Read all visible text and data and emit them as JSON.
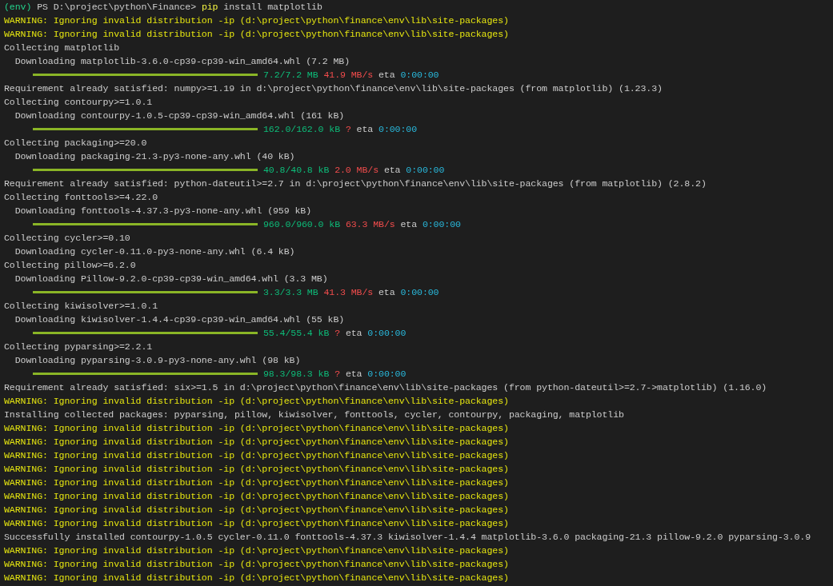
{
  "terminal": {
    "lines": [
      {
        "kind": "prompt",
        "env": "(env)",
        "path": " PS D:\\project\\python\\Finance> ",
        "command": "pip",
        "args": " install matplotlib"
      },
      {
        "kind": "warning",
        "text": "WARNING: Ignoring invalid distribution -ip (d:\\project\\python\\finance\\env\\lib\\site-packages)"
      },
      {
        "kind": "warning",
        "text": "WARNING: Ignoring invalid distribution -ip (d:\\project\\python\\finance\\env\\lib\\site-packages)"
      },
      {
        "kind": "text",
        "text": "Collecting matplotlib"
      },
      {
        "kind": "text",
        "text": "  Downloading matplotlib-3.6.0-cp39-cp39-win_amd64.whl (7.2 MB)"
      },
      {
        "kind": "progress",
        "level": 1,
        "size": "7.2/7.2 MB",
        "speed": "41.9 MB/s",
        "eta_label": "eta",
        "eta": "0:00:00"
      },
      {
        "kind": "text",
        "text": "Requirement already satisfied: numpy>=1.19 in d:\\project\\python\\finance\\env\\lib\\site-packages (from matplotlib) (1.23.3)"
      },
      {
        "kind": "text",
        "text": "Collecting contourpy>=1.0.1"
      },
      {
        "kind": "text",
        "text": "  Downloading contourpy-1.0.5-cp39-cp39-win_amd64.whl (161 kB)"
      },
      {
        "kind": "progress",
        "level": 1,
        "size": "162.0/162.0 kB",
        "speed": "?",
        "eta_label": "eta",
        "eta": "0:00:00"
      },
      {
        "kind": "text",
        "text": "Collecting packaging>=20.0"
      },
      {
        "kind": "text",
        "text": "  Downloading packaging-21.3-py3-none-any.whl (40 kB)"
      },
      {
        "kind": "progress",
        "level": 1,
        "size": "40.8/40.8 kB",
        "speed": "2.0 MB/s",
        "eta_label": "eta",
        "eta": "0:00:00"
      },
      {
        "kind": "text",
        "text": "Requirement already satisfied: python-dateutil>=2.7 in d:\\project\\python\\finance\\env\\lib\\site-packages (from matplotlib) (2.8.2)"
      },
      {
        "kind": "text",
        "text": "Collecting fonttools>=4.22.0"
      },
      {
        "kind": "text",
        "text": "  Downloading fonttools-4.37.3-py3-none-any.whl (959 kB)"
      },
      {
        "kind": "progress",
        "level": 1,
        "size": "960.0/960.0 kB",
        "speed": "63.3 MB/s",
        "eta_label": "eta",
        "eta": "0:00:00"
      },
      {
        "kind": "text",
        "text": "Collecting cycler>=0.10"
      },
      {
        "kind": "text",
        "text": "  Downloading cycler-0.11.0-py3-none-any.whl (6.4 kB)"
      },
      {
        "kind": "text",
        "text": "Collecting pillow>=6.2.0"
      },
      {
        "kind": "text",
        "text": "  Downloading Pillow-9.2.0-cp39-cp39-win_amd64.whl (3.3 MB)"
      },
      {
        "kind": "progress",
        "level": 1,
        "size": "3.3/3.3 MB",
        "speed": "41.3 MB/s",
        "eta_label": "eta",
        "eta": "0:00:00"
      },
      {
        "kind": "text",
        "text": "Collecting kiwisolver>=1.0.1"
      },
      {
        "kind": "text",
        "text": "  Downloading kiwisolver-1.4.4-cp39-cp39-win_amd64.whl (55 kB)"
      },
      {
        "kind": "progress",
        "level": 1,
        "size": "55.4/55.4 kB",
        "speed": "?",
        "eta_label": "eta",
        "eta": "0:00:00"
      },
      {
        "kind": "text",
        "text": "Collecting pyparsing>=2.2.1"
      },
      {
        "kind": "text",
        "text": "  Downloading pyparsing-3.0.9-py3-none-any.whl (98 kB)"
      },
      {
        "kind": "progress",
        "level": 1,
        "size": "98.3/98.3 kB",
        "speed": "?",
        "eta_label": "eta",
        "eta": "0:00:00"
      },
      {
        "kind": "text",
        "text": "Requirement already satisfied: six>=1.5 in d:\\project\\python\\finance\\env\\lib\\site-packages (from python-dateutil>=2.7->matplotlib) (1.16.0)"
      },
      {
        "kind": "warning",
        "text": "WARNING: Ignoring invalid distribution -ip (d:\\project\\python\\finance\\env\\lib\\site-packages)"
      },
      {
        "kind": "text",
        "text": "Installing collected packages: pyparsing, pillow, kiwisolver, fonttools, cycler, contourpy, packaging, matplotlib"
      },
      {
        "kind": "warning",
        "text": "WARNING: Ignoring invalid distribution -ip (d:\\project\\python\\finance\\env\\lib\\site-packages)"
      },
      {
        "kind": "warning",
        "text": "WARNING: Ignoring invalid distribution -ip (d:\\project\\python\\finance\\env\\lib\\site-packages)"
      },
      {
        "kind": "warning",
        "text": "WARNING: Ignoring invalid distribution -ip (d:\\project\\python\\finance\\env\\lib\\site-packages)"
      },
      {
        "kind": "warning",
        "text": "WARNING: Ignoring invalid distribution -ip (d:\\project\\python\\finance\\env\\lib\\site-packages)"
      },
      {
        "kind": "warning",
        "text": "WARNING: Ignoring invalid distribution -ip (d:\\project\\python\\finance\\env\\lib\\site-packages)"
      },
      {
        "kind": "warning",
        "text": "WARNING: Ignoring invalid distribution -ip (d:\\project\\python\\finance\\env\\lib\\site-packages)"
      },
      {
        "kind": "warning",
        "text": "WARNING: Ignoring invalid distribution -ip (d:\\project\\python\\finance\\env\\lib\\site-packages)"
      },
      {
        "kind": "warning",
        "text": "WARNING: Ignoring invalid distribution -ip (d:\\project\\python\\finance\\env\\lib\\site-packages)"
      },
      {
        "kind": "text",
        "text": "Successfully installed contourpy-1.0.5 cycler-0.11.0 fonttools-4.37.3 kiwisolver-1.4.4 matplotlib-3.6.0 packaging-21.3 pillow-9.2.0 pyparsing-3.0.9"
      },
      {
        "kind": "warning",
        "text": "WARNING: Ignoring invalid distribution -ip (d:\\project\\python\\finance\\env\\lib\\site-packages)"
      },
      {
        "kind": "warning",
        "text": "WARNING: Ignoring invalid distribution -ip (d:\\project\\python\\finance\\env\\lib\\site-packages)"
      },
      {
        "kind": "warning",
        "text": "WARNING: Ignoring invalid distribution -ip (d:\\project\\python\\finance\\env\\lib\\site-packages)"
      }
    ]
  }
}
